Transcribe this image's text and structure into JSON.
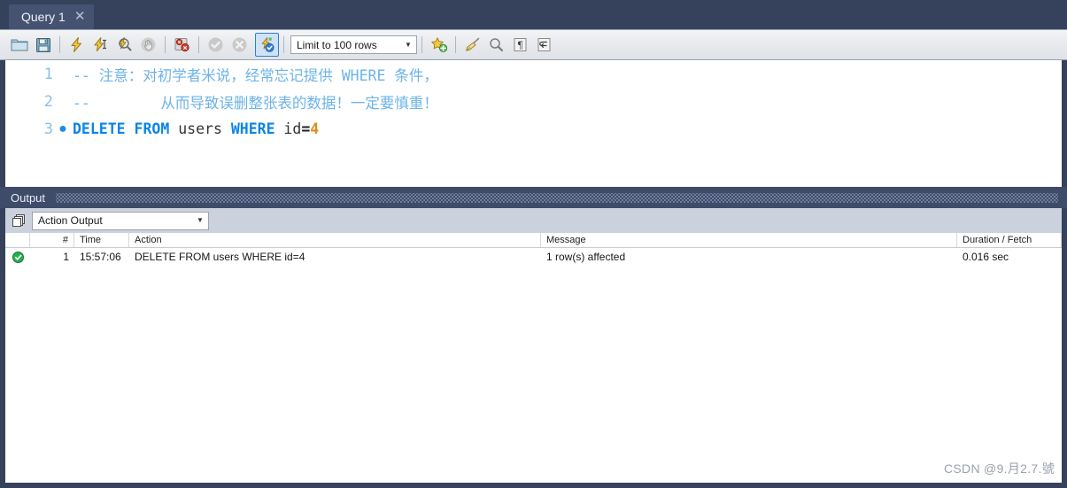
{
  "window": {
    "tab": {
      "label": "Query 1",
      "close_icon": "close-icon"
    }
  },
  "toolbar": {
    "buttons": [
      {
        "name": "open-sql-script-button",
        "icon": "folder-icon"
      },
      {
        "name": "save-sql-script-button",
        "icon": "floppy-disk-icon"
      },
      {
        "name": "execute-statement-button",
        "icon": "lightning-bolt-icon"
      },
      {
        "name": "execute-current-statement-button",
        "icon": "lightning-bolt-cursor-icon"
      },
      {
        "name": "explain-statement-button",
        "icon": "magnifier-lightning-icon"
      },
      {
        "name": "stop-statement-button",
        "icon": "stop-hand-icon"
      },
      {
        "name": "toggle-stop-on-error-button",
        "icon": "stop-on-error-icon"
      },
      {
        "name": "commit-button",
        "icon": "check-circle-icon"
      },
      {
        "name": "rollback-button",
        "icon": "cancel-circle-icon"
      },
      {
        "name": "toggle-autocommit-button",
        "icon": "autocommit-icon"
      }
    ],
    "limit_select": {
      "value": "Limit to 100 rows",
      "arrow_icon": "chevron-down-icon"
    },
    "right_buttons": [
      {
        "name": "save-snippet-button",
        "icon": "star-plus-icon"
      },
      {
        "name": "beautify-sql-button",
        "icon": "broom-icon"
      },
      {
        "name": "find-button",
        "icon": "magnifier-icon"
      },
      {
        "name": "toggle-invisible-chars-button",
        "icon": "pilcrow-icon"
      },
      {
        "name": "toggle-wrapping-button",
        "icon": "word-wrap-icon"
      }
    ]
  },
  "editor": {
    "lines": [
      {
        "number": "1",
        "has_marker": false,
        "tokens": [
          {
            "type": "cmt",
            "text": "-- 注意：对初学者米说，经常忘记提供 WHERE 条件，"
          }
        ]
      },
      {
        "number": "2",
        "has_marker": false,
        "tokens": [
          {
            "type": "cmt",
            "text": "--        从而导致误删整张表的数据！一定要慎重！"
          }
        ]
      },
      {
        "number": "3",
        "has_marker": true,
        "tokens": [
          {
            "type": "kw",
            "text": "DELETE FROM"
          },
          {
            "type": "ident",
            "text": " users "
          },
          {
            "type": "kw",
            "text": "WHERE"
          },
          {
            "type": "ident",
            "text": " id"
          },
          {
            "type": "op",
            "text": "="
          },
          {
            "type": "num",
            "text": "4"
          }
        ]
      }
    ]
  },
  "output": {
    "panel_title": "Output",
    "stack_icon": "stacked-panes-icon",
    "view_select": {
      "value": "Action Output",
      "arrow_icon": "chevron-down-icon"
    },
    "columns": [
      {
        "key": "status",
        "label": ""
      },
      {
        "key": "num",
        "label": "#"
      },
      {
        "key": "time",
        "label": "Time"
      },
      {
        "key": "action",
        "label": "Action"
      },
      {
        "key": "message",
        "label": "Message"
      },
      {
        "key": "duration",
        "label": "Duration / Fetch"
      }
    ],
    "rows": [
      {
        "status": "success",
        "status_icon": "green-check-icon",
        "num": "1",
        "time": "15:57:06",
        "action": "DELETE FROM users WHERE id=4",
        "message": "1 row(s) affected",
        "duration": "0.016 sec"
      }
    ]
  },
  "watermark": {
    "text": "CSDN @9.月2.7.號"
  },
  "colors": {
    "chrome_dark": "#36415c",
    "tab_active": "#465272",
    "panel_header": "#3e4b69",
    "keyword_blue": "#0a84e8",
    "comment_blue": "#6db3e8",
    "number_orange": "#e08a1e",
    "success_green": "#22b14c",
    "accent_select": "#2f7fd1"
  }
}
